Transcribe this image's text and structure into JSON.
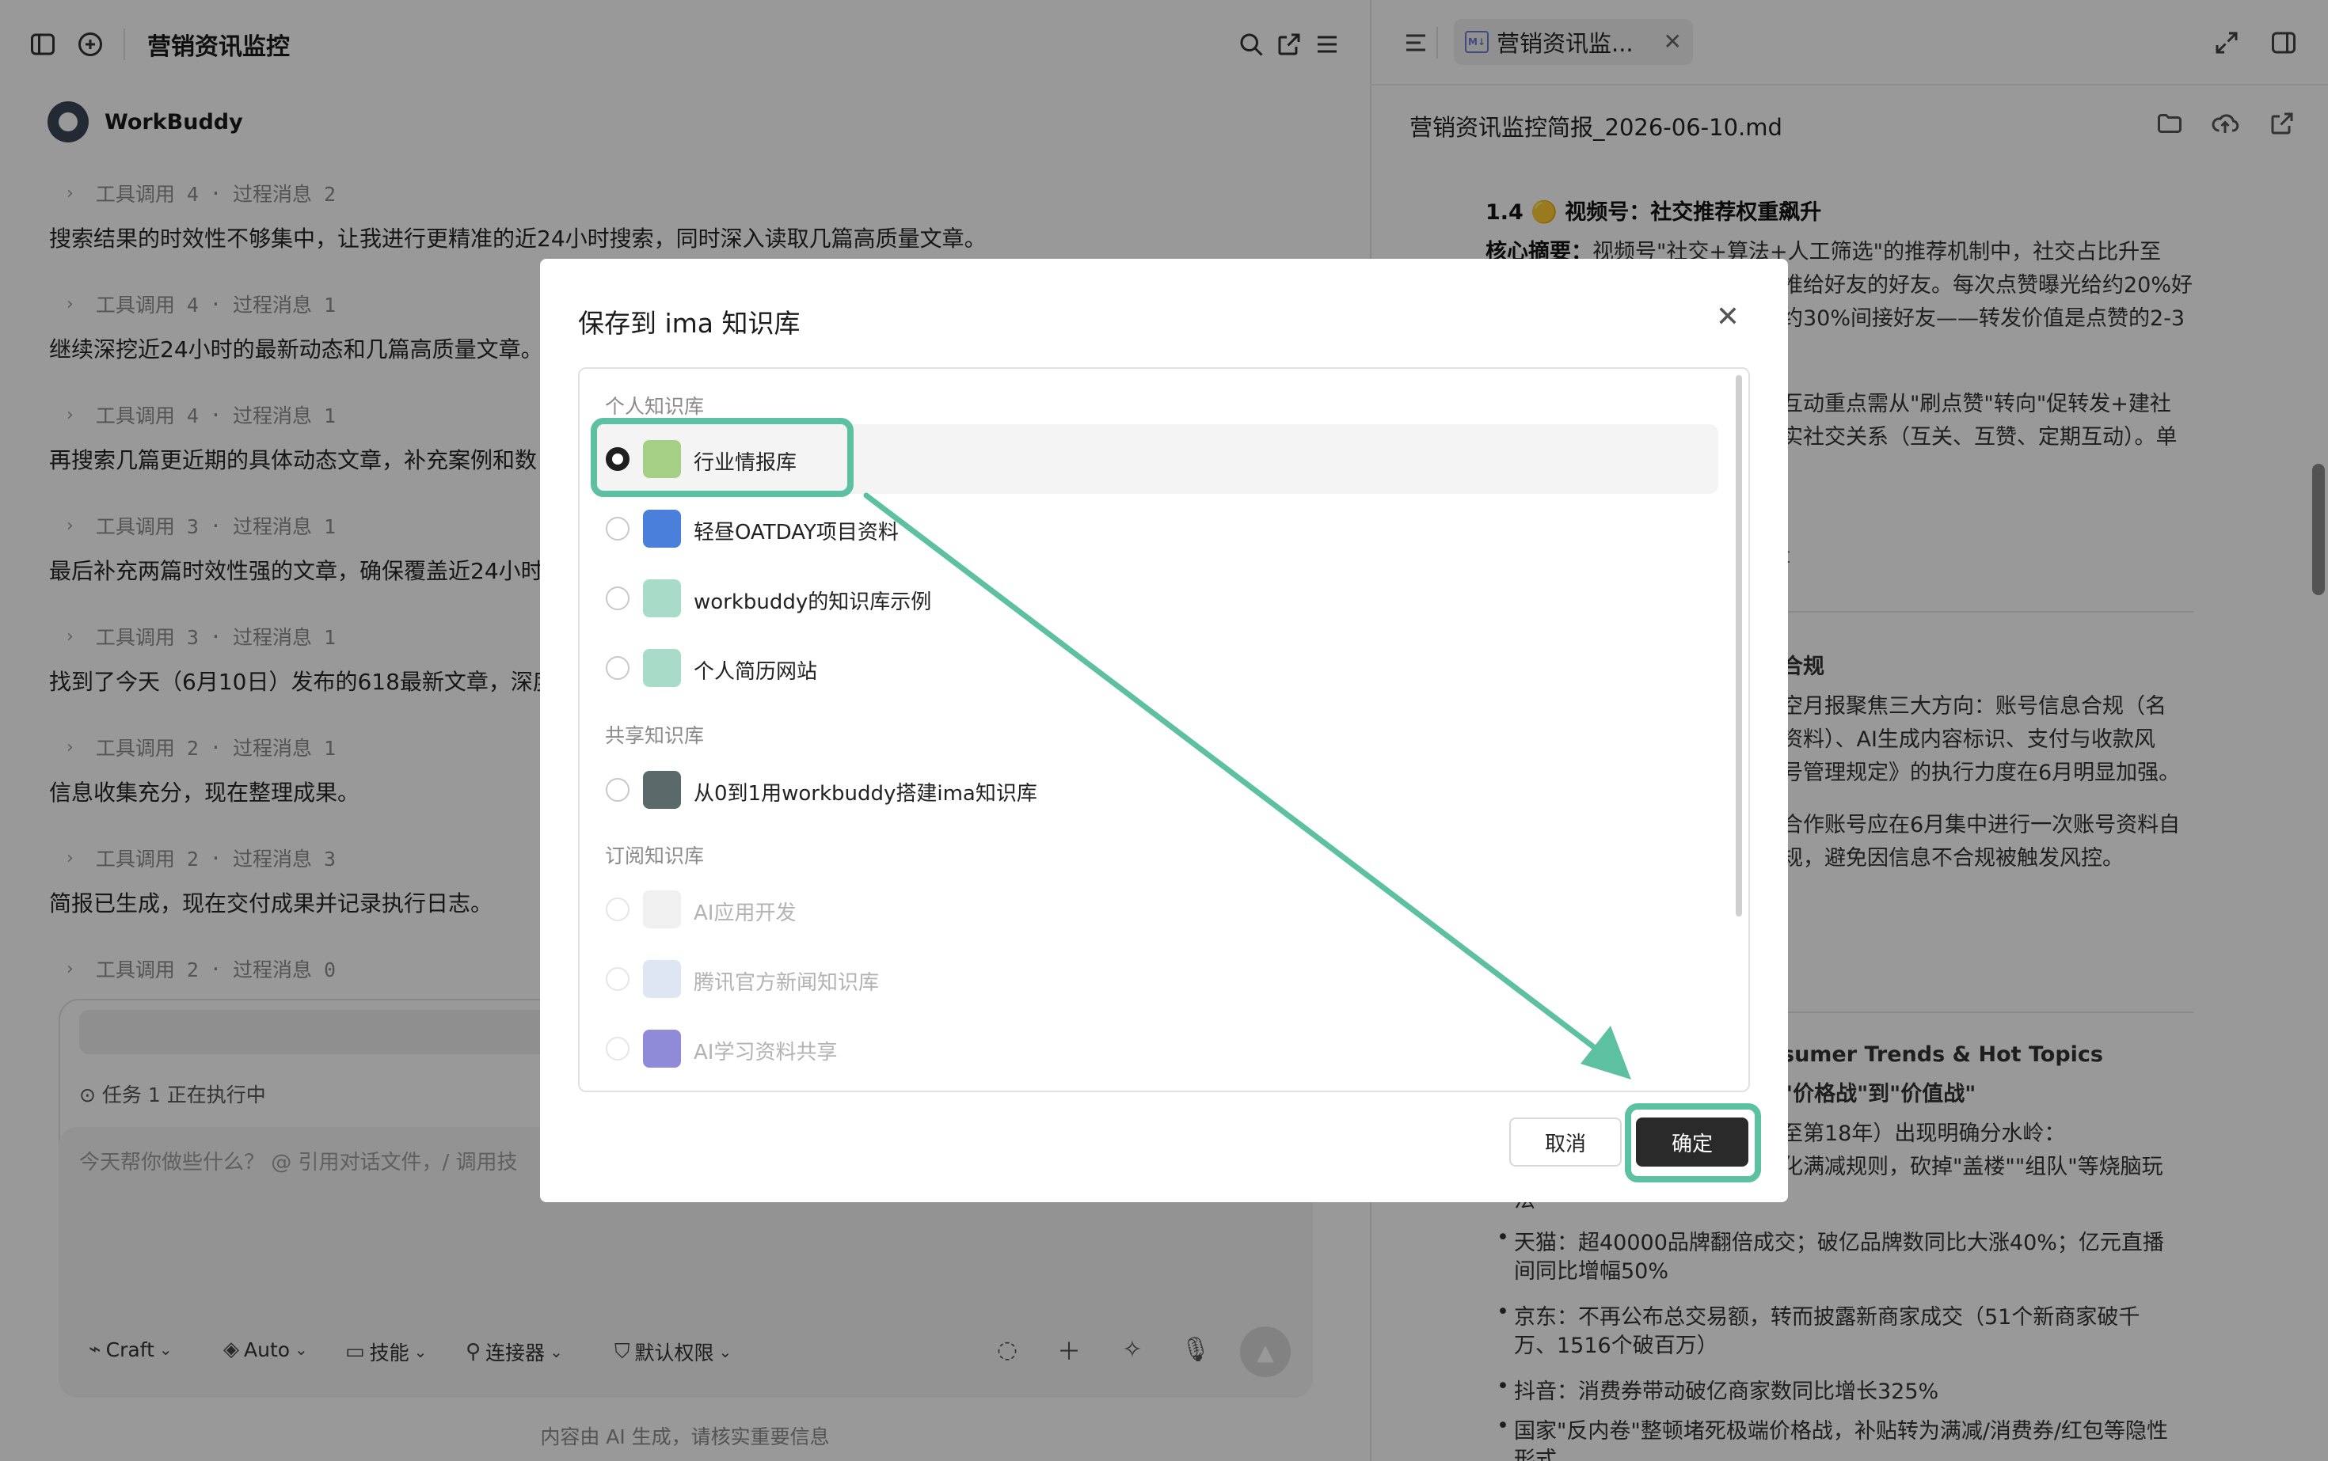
{
  "left": {
    "title": "营销资讯监控",
    "bot_name": "WorkBuddy",
    "steps": [
      {
        "meta_tool": "工具调用 4",
        "meta_proc": "过程消息 2",
        "text": "搜索结果的时效性不够集中，让我进行更精准的近24小时搜索，同时深入读取几篇高质量文章。"
      },
      {
        "meta_tool": "工具调用 4",
        "meta_proc": "过程消息 1",
        "text": "继续深挖近24小时的最新动态和几篇高质量文章。"
      },
      {
        "meta_tool": "工具调用 4",
        "meta_proc": "过程消息 1",
        "text": "再搜索几篇更近期的具体动态文章，补充案例和数"
      },
      {
        "meta_tool": "工具调用 3",
        "meta_proc": "过程消息 1",
        "text": "最后补充两篇时效性强的文章，确保覆盖近24小时"
      },
      {
        "meta_tool": "工具调用 3",
        "meta_proc": "过程消息 1",
        "text": "找到了今天（6月10日）发布的618最新文章，深度"
      },
      {
        "meta_tool": "工具调用 2",
        "meta_proc": "过程消息 1",
        "text": "信息收集充分，现在整理成果。"
      },
      {
        "meta_tool": "工具调用 2",
        "meta_proc": "过程消息 3",
        "text": "简报已生成，现在交付成果并记录执行日志。"
      },
      {
        "meta_tool": "工具调用 2",
        "meta_proc": "过程消息 0",
        "text": ""
      }
    ],
    "meta_sep": "·",
    "task_status": "任务 1 正在执行中",
    "prompt_placeholder": "今天帮你做些什么？ @ 引用对话文件，/ 调用技",
    "toolbar": {
      "craft": "Craft",
      "auto": "Auto",
      "skills": "技能",
      "connectors": "连接器",
      "permissions": "默认权限"
    },
    "disclaimer": "内容由 AI 生成，请核实重要信息"
  },
  "right": {
    "tab_label": "营销资讯监...",
    "tab_badge": "M↓",
    "file_title": "营销资讯监控简报_2026-06-10.md",
    "section_heading": "1.4 🟡 视频号：社交推荐权重飙升",
    "summary_label": "核心摘要：",
    "summary_text": "视频号\"社交+算法+人工筛选\"的推荐机制中，社交占比升至",
    "lines": [
      "推给好友的好友。每次点赞曝光给约20%好",
      "约30%间接好友——转发价值是点赞的2-3",
      "互动重点需从\"刷点赞\"转向\"促转发+建社",
      "实社交关系（互关、互赞、定期互动）。单",
      "t",
      "合规",
      "空月报聚焦三大方向：账号信息合规（名",
      "资料）、AI生成内容标识、支付与收款风",
      "号管理规定》的执行力度在6月明显加强。",
      "合作账号应在6月集中进行一次账号资料自",
      "规，避免因信息不合规被触发风控。",
      "sumer Trends & Hot Topics",
      "\"价格战\"到\"价值战\"",
      "至第18年）出现明确分水岭：",
      "化满减规则，砍掉\"盖楼\"\"组队\"等烧脑玩",
      "法"
    ],
    "bullets": [
      "天猫：超40000品牌翻倍成交；破亿品牌数同比大涨40%；亿元直播",
      "间同比增幅50%",
      "京东：不再公布总交易额，转而披露新商家成交（51个新商家破千",
      "万、1516个破百万）",
      "抖音：消费券带动破亿商家数同比增长325%",
      "国家\"反内卷\"整顿堵死极端价格战，补贴转为满减/消费券/红包等隐性",
      "形式"
    ]
  },
  "modal": {
    "title": "保存到 ima 知识库",
    "close": "✕",
    "sections": {
      "personal": "个人知识库",
      "shared": "共享知识库",
      "subscribed": "订阅知识库"
    },
    "personal_items": [
      "行业情报库",
      "轻昼OATDAY项目资料",
      "workbuddy的知识库示例",
      "个人简历网站"
    ],
    "shared_items": [
      "从0到1用workbuddy搭建ima知识库"
    ],
    "subscribed_items": [
      "AI应用开发",
      "腾讯官方新闻知识库",
      "AI学习资料共享"
    ],
    "selected": "行业情报库",
    "cancel": "取消",
    "confirm": "确定"
  },
  "colors": {
    "annotation": "#5cc0a1",
    "confirm_bg": "#2a2a2a",
    "overlay": "rgba(0,0,0,0.40)"
  },
  "icons": [
    "sidebar-toggle-icon",
    "new-chat-icon",
    "search-icon",
    "share-icon",
    "menu-icon",
    "outline-icon",
    "expand-icon",
    "panel-icon",
    "folder-icon",
    "upload-icon",
    "open-external-icon"
  ]
}
